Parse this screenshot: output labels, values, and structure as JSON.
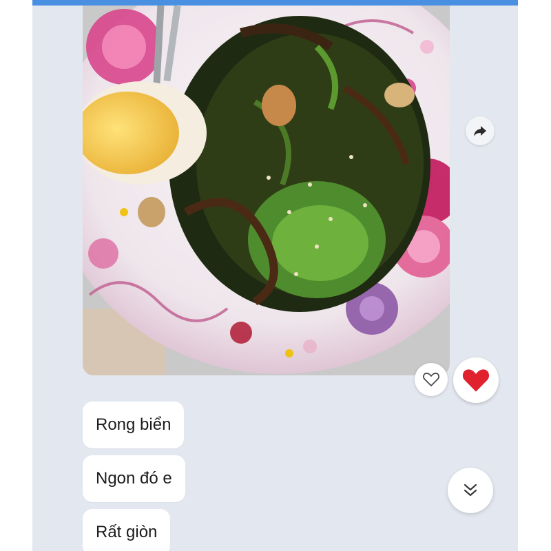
{
  "messages": [
    {
      "text": "Rong biển"
    },
    {
      "text": "Ngon đó e"
    },
    {
      "text": "Rất giòn"
    }
  ],
  "photo": {
    "subject": "photo-message"
  },
  "actions": {
    "share_icon": "share-arrow-icon",
    "like_outline_icon": "heart-outline-icon",
    "like_filled_icon": "heart-filled-icon",
    "scroll_down_icon": "double-chevron-down-icon"
  },
  "colors": {
    "background": "#e3e7ef",
    "bubble": "#ffffff",
    "heart": "#e0222e",
    "topbar": "#4a90e2"
  }
}
